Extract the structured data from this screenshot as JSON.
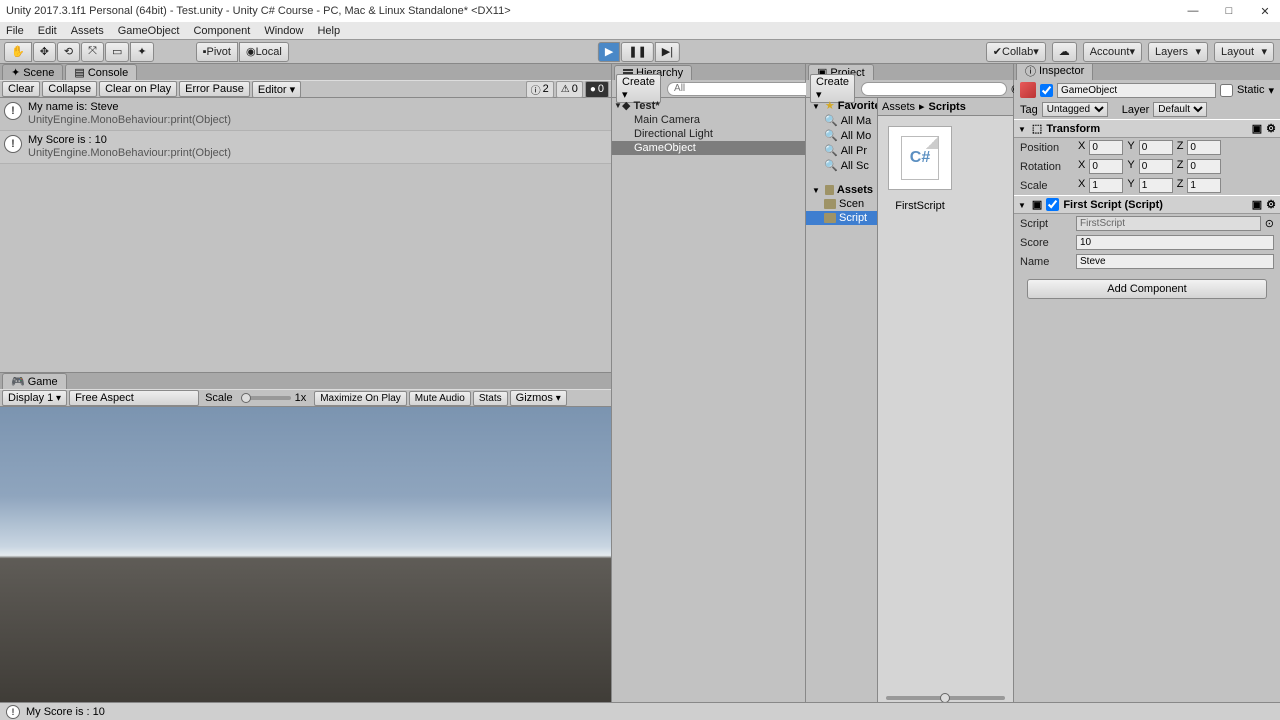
{
  "window": {
    "title": "Unity 2017.3.1f1 Personal (64bit) - Test.unity - Unity C# Course - PC, Mac & Linux Standalone* <DX11>",
    "min": "—",
    "max": "□",
    "close": "✕"
  },
  "menu": {
    "file": "File",
    "edit": "Edit",
    "assets": "Assets",
    "go": "GameObject",
    "comp": "Component",
    "window": "Window",
    "help": "Help"
  },
  "toolbar": {
    "pivot": "Pivot",
    "local": "Local",
    "collab": "Collab",
    "account": "Account",
    "layers": "Layers",
    "layout": "Layout",
    "cloud": "☁",
    "play": "▶",
    "pause": "❚❚",
    "step": "▶|"
  },
  "tabs": {
    "scene": "Scene",
    "console": "Console",
    "game": "Game",
    "hierarchy": "Hierarchy",
    "project": "Project",
    "inspector": "Inspector"
  },
  "console": {
    "clear": "Clear",
    "collapse": "Collapse",
    "cop": "Clear on Play",
    "ep": "Error Pause",
    "editor": "Editor",
    "c_info": "2",
    "c_warn": "0",
    "c_err": "0",
    "msgs": [
      {
        "line1": "My name is: Steve",
        "line2": "UnityEngine.MonoBehaviour:print(Object)",
        "icon": "!"
      },
      {
        "line1": "My Score is : 10",
        "line2": "UnityEngine.MonoBehaviour:print(Object)",
        "icon": "!"
      }
    ]
  },
  "gamebar": {
    "display": "Display 1",
    "aspect": "Free Aspect",
    "scale": "Scale",
    "scaleval": "1x",
    "mop": "Maximize On Play",
    "mute": "Mute Audio",
    "stats": "Stats",
    "gizmos": "Gizmos"
  },
  "hierarchy": {
    "create": "Create",
    "search": "All",
    "scene": "Test*",
    "items": [
      "Main Camera",
      "Directional Light",
      "GameObject"
    ],
    "selected": 2
  },
  "project": {
    "create": "Create",
    "favorites": "Favorites",
    "fav_items": [
      "All Ma",
      "All Mo",
      "All Pr",
      "All Sc"
    ],
    "assets": "Assets",
    "a_items": [
      "Scen",
      "Script"
    ],
    "a_sel": 1,
    "crumb": [
      "Assets",
      "Scripts"
    ],
    "file": "FirstScript"
  },
  "inspector": {
    "name": "GameObject",
    "static": "Static",
    "tag_l": "Tag",
    "tag": "Untagged",
    "layer_l": "Layer",
    "layer": "Default",
    "transform": {
      "title": "Transform",
      "pos": "Position",
      "rot": "Rotation",
      "scale": "Scale",
      "px": "0",
      "py": "0",
      "pz": "0",
      "rx": "0",
      "ry": "0",
      "rz": "0",
      "sx": "1",
      "sy": "1",
      "sz": "1",
      "x": "X",
      "y": "Y",
      "z": "Z"
    },
    "script": {
      "title": "First Script (Script)",
      "script_l": "Script",
      "script_v": "FirstScript",
      "score_l": "Score",
      "score_v": "10",
      "name_l": "Name",
      "name_v": "Steve"
    },
    "addcomp": "Add Component"
  },
  "statusbar": {
    "msg": "My Score is : 10",
    "icon": "!"
  }
}
